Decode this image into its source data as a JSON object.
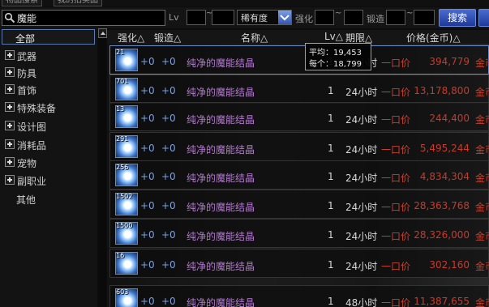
{
  "tabs": [
    "物品搜索",
    "我的拍卖品"
  ],
  "search": {
    "query": "魔能"
  },
  "filters": {
    "level_label": "Lv",
    "level_sep": "~",
    "rarity_value": "稀有度",
    "enhance_label": "强化",
    "enhance_sep": "~",
    "forge_label": "锻造",
    "forge_sep": "~",
    "search_button": "搜索"
  },
  "sidebar": {
    "items": [
      {
        "label": "全部"
      },
      {
        "label": "武器"
      },
      {
        "label": "防具"
      },
      {
        "label": "首饰"
      },
      {
        "label": "特殊装备"
      },
      {
        "label": "设计图"
      },
      {
        "label": "消耗品"
      },
      {
        "label": "宠物"
      },
      {
        "label": "副职业"
      },
      {
        "label": "其他"
      }
    ]
  },
  "table": {
    "headers": {
      "enhance": "强化△",
      "forge": "锻造△",
      "name": "名称△",
      "lv": "Lv△",
      "period": "期限△",
      "price": "价格(金币)△"
    },
    "rows": [
      {
        "qty": "21",
        "enhance": "+0",
        "forge": "+0",
        "name": "纯净的魔能结晶",
        "count": "1",
        "duration": "24小时",
        "mode": "一口价",
        "price": "394,779",
        "unit": "金币"
      },
      {
        "qty": "701",
        "enhance": "+0",
        "forge": "+0",
        "name": "纯净的魔能结晶",
        "count": "1",
        "duration": "24小时",
        "mode": "一口价",
        "price": "13,178,800",
        "unit": "金币"
      },
      {
        "qty": "13",
        "enhance": "+0",
        "forge": "+0",
        "name": "纯净的魔能结晶",
        "count": "1",
        "duration": "24小时",
        "mode": "一口价",
        "price": "244,400",
        "unit": "金币"
      },
      {
        "qty": "291",
        "enhance": "+0",
        "forge": "+0",
        "name": "纯净的魔能结晶",
        "count": "1",
        "duration": "24小时",
        "mode": "一口价",
        "price": "5,495,244",
        "unit": "金币"
      },
      {
        "qty": "256",
        "enhance": "+0",
        "forge": "+0",
        "name": "纯净的魔能结晶",
        "count": "1",
        "duration": "24小时",
        "mode": "一口价",
        "price": "4,834,304",
        "unit": "金币"
      },
      {
        "qty": "1502",
        "enhance": "+0",
        "forge": "+0",
        "name": "纯净的魔能结晶",
        "count": "1",
        "duration": "24小时",
        "mode": "一口价",
        "price": "28,363,768",
        "unit": "金币"
      },
      {
        "qty": "1500",
        "enhance": "+0",
        "forge": "+0",
        "name": "纯净的魔能结晶",
        "count": "1",
        "duration": "24小时",
        "mode": "一口价",
        "price": "28,326,000",
        "unit": "金币"
      },
      {
        "qty": "16",
        "enhance": "+0",
        "forge": "+0",
        "name": "纯净的魔能结晶",
        "count": "1",
        "duration": "24小时",
        "mode": "一口价",
        "price": "302,160",
        "unit": "金币"
      },
      {
        "qty": "603",
        "enhance": "+0",
        "forge": "+0",
        "name": "纯净的魔能结晶",
        "count": "1",
        "duration": "48小时",
        "mode": "一口价",
        "price": "11,387,655",
        "unit": "金币"
      }
    ]
  },
  "tooltip": {
    "avg_label": "平均：",
    "avg_value": "19,453",
    "each_label": "每个：",
    "each_value": "18,799"
  },
  "colors": {
    "accent_blue": "#3556b0",
    "name_purple": "#b47ad0",
    "price_red": "#c83a2a",
    "plus_blue": "#7aa0e0"
  }
}
